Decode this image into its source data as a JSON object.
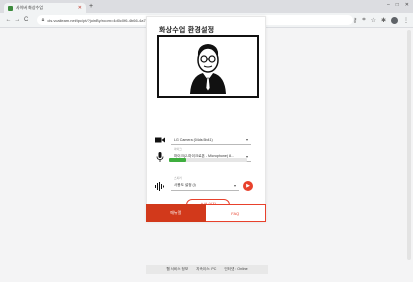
{
  "browser": {
    "tab_title": "사이버 화상수업",
    "url": "cls.vcaileam.net/ipc/pt/?joinBy/room=4d0c0f6-4b66-4a7e-b2f2-3625d63d5f7a&code=27508",
    "controls": {
      "back": "←",
      "forward": "→",
      "reload": "C",
      "new_tab": "+",
      "minimize": "–",
      "maximize": "□",
      "close": "✕"
    }
  },
  "setup": {
    "title": "화상수업 환경설정",
    "camera": {
      "value": "LG Camera (04ds:5b41)"
    },
    "microphone": {
      "label": "마이크",
      "value": "마이크(2-마이크로폰 - Microphone) 8..."
    },
    "mic_level": 0.22,
    "speaker": {
      "label": "스피커",
      "value": "사용도 설정 (i)"
    },
    "join_button": "수업 입장"
  },
  "bottom_tabs": {
    "manual": "매뉴얼",
    "faq": "FAQ"
  },
  "footer": {
    "service": "웹 서비스 정보",
    "mode": "지속이스: PC",
    "status": "인터넷 : Online"
  },
  "colors": {
    "accent": "#e8412c",
    "active_tab": "#d2391b",
    "level": "#3fae3f"
  }
}
